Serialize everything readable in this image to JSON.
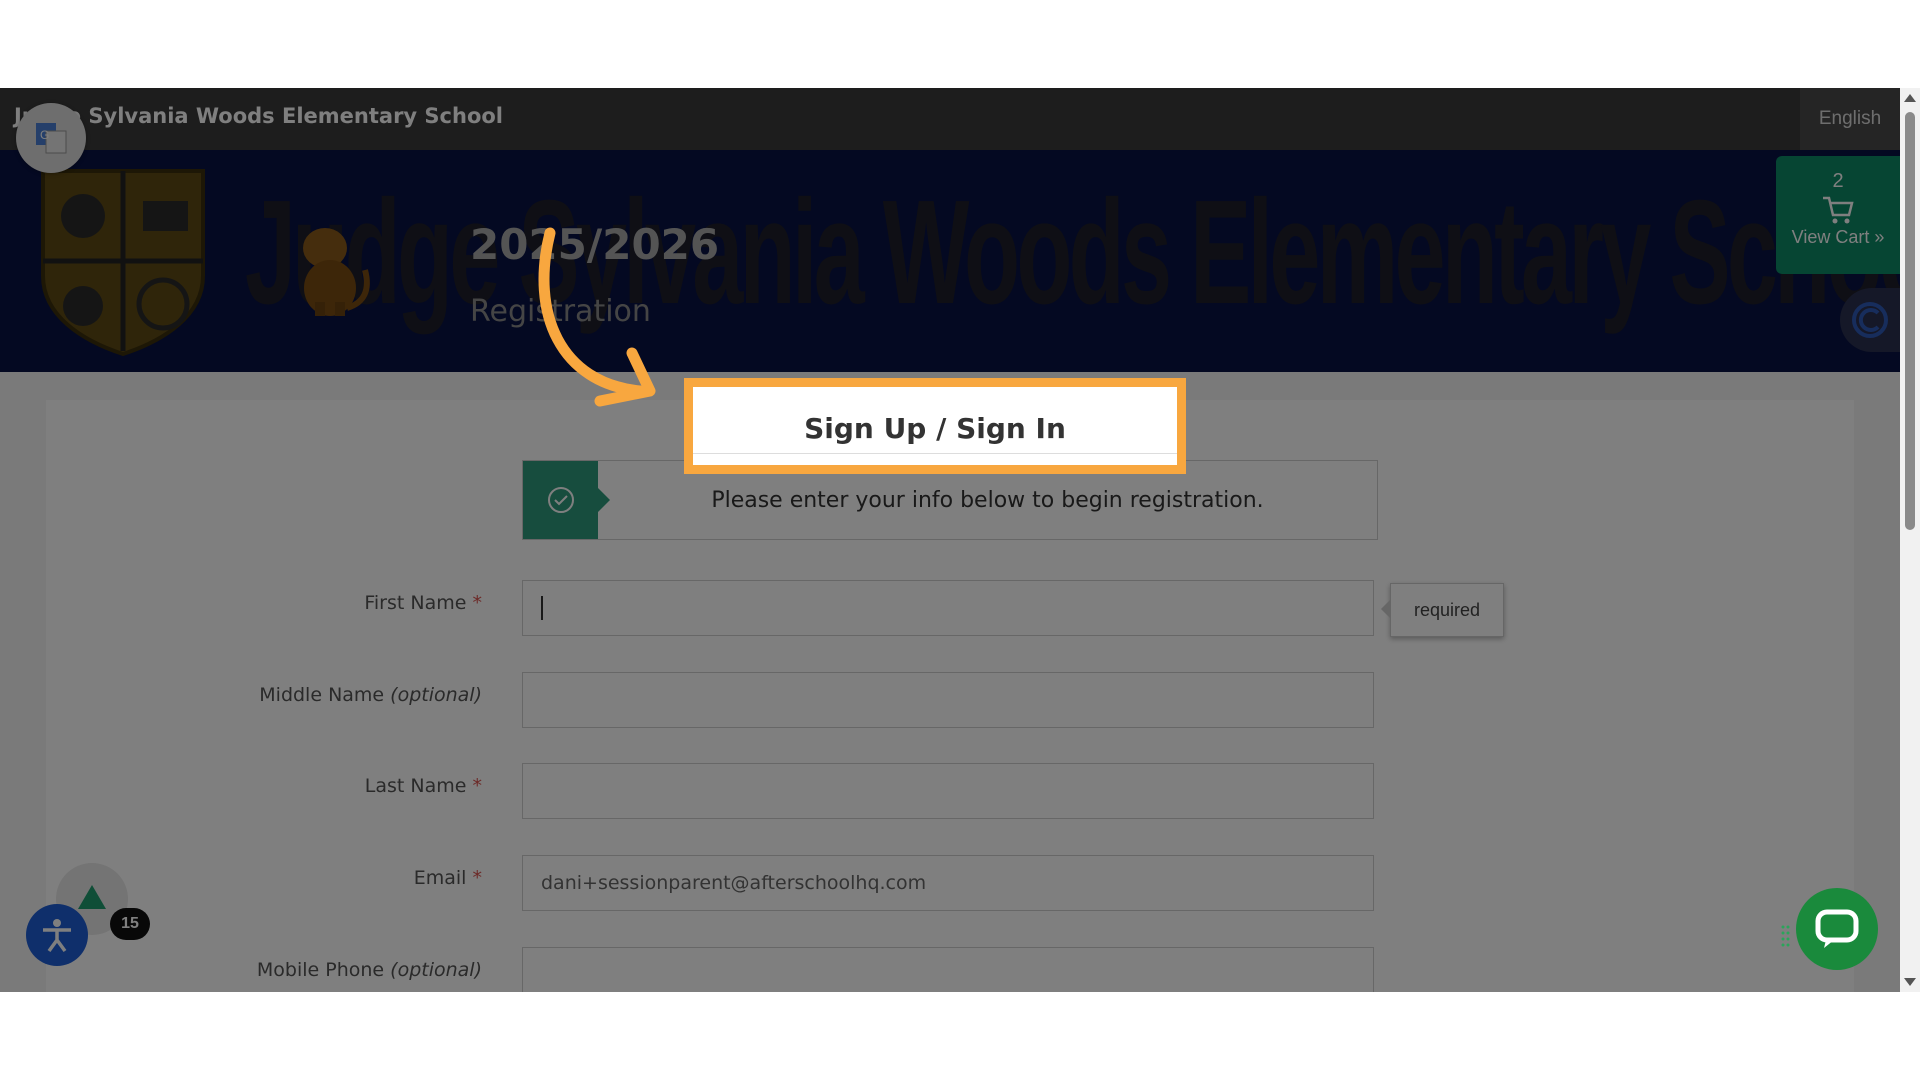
{
  "header": {
    "school_name": "Judge Sylvania Woods Elementary School",
    "language": "English"
  },
  "banner": {
    "background_text": "Judge Sylvania Woods Elementary School",
    "year": "2025/2026",
    "subtitle": "Registration"
  },
  "cart": {
    "count": "2",
    "label": "View Cart »",
    "icon": "cart-icon"
  },
  "form": {
    "title": "Sign Up / Sign In",
    "notice": "Please enter your info below to begin registration.",
    "first_name": {
      "label": "First Name",
      "required_mark": "*",
      "value": "",
      "tooltip": "required"
    },
    "middle_name": {
      "label": "Middle Name",
      "optional": "(optional)",
      "value": ""
    },
    "last_name": {
      "label": "Last Name",
      "required_mark": "*",
      "value": ""
    },
    "email": {
      "label": "Email",
      "required_mark": "*",
      "value": "dani+sessionparent@afterschoolhq.com"
    },
    "mobile": {
      "label": "Mobile Phone",
      "optional": "(optional)",
      "value": ""
    }
  },
  "widgets": {
    "badge_count": "15"
  },
  "colors": {
    "highlight": "#f8a73f",
    "accent_green": "#0d8a66",
    "banner_navy": "#081244"
  }
}
